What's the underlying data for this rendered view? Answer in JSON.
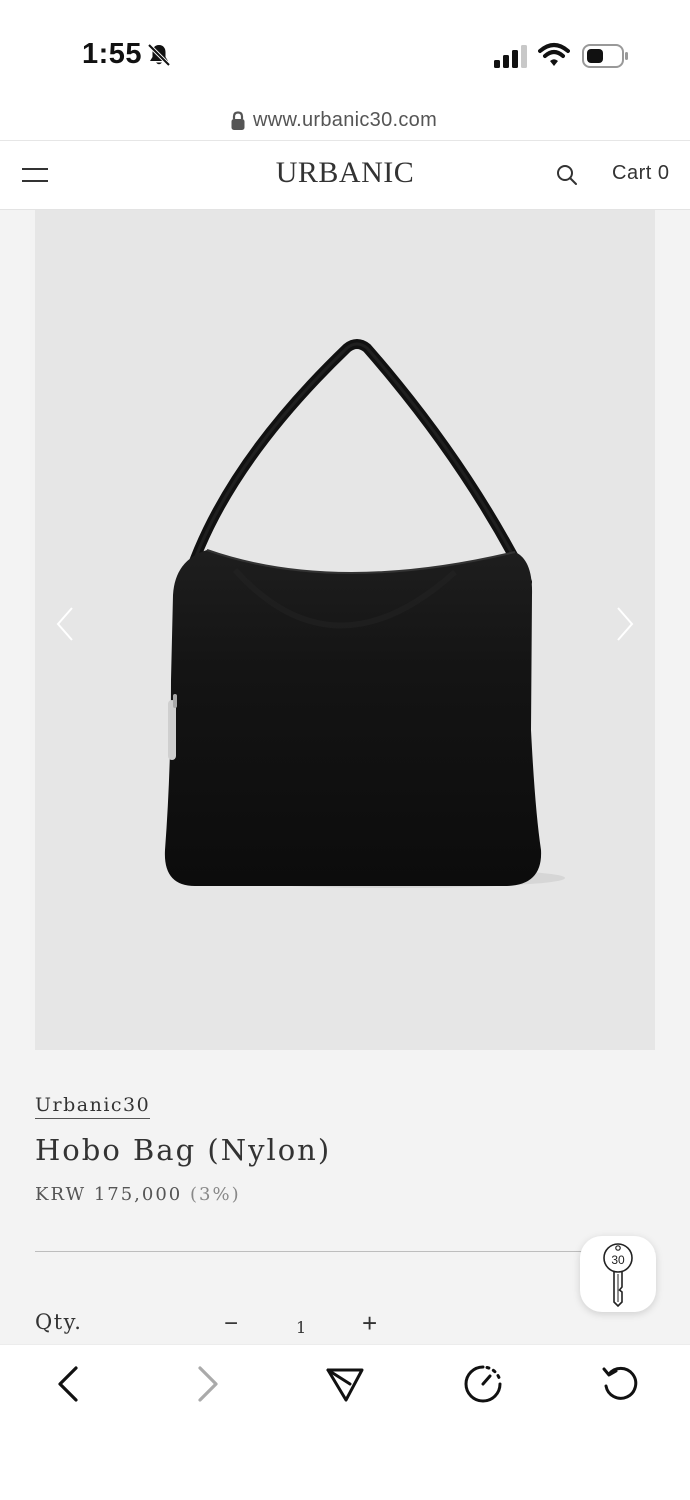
{
  "status_bar": {
    "time": "1:55"
  },
  "url_bar": {
    "url": "www.urbanic30.com"
  },
  "header": {
    "logo": "URBANIC",
    "cart_label": "Cart 0"
  },
  "product": {
    "brand": "Urbanic30",
    "title": "Hobo Bag (Nylon)",
    "price": "KRW 175,000",
    "discount": "(3%)",
    "qty_label": "Qty.",
    "qty_minus": "−",
    "qty_value": "1",
    "qty_plus": "+"
  },
  "floating_button": {
    "badge": "30"
  },
  "colors": {
    "page_bg": "#f3f3f3",
    "image_bg": "#e6e6e6",
    "bag": "#141414"
  },
  "icons": [
    "bell-slash-icon",
    "signal-icon",
    "wifi-icon",
    "battery-icon",
    "lock-icon",
    "menu-icon",
    "search-icon",
    "chevron-left-icon",
    "chevron-right-icon",
    "key-icon",
    "back-icon",
    "forward-icon",
    "share-icon",
    "speed-icon",
    "reload-icon"
  ]
}
